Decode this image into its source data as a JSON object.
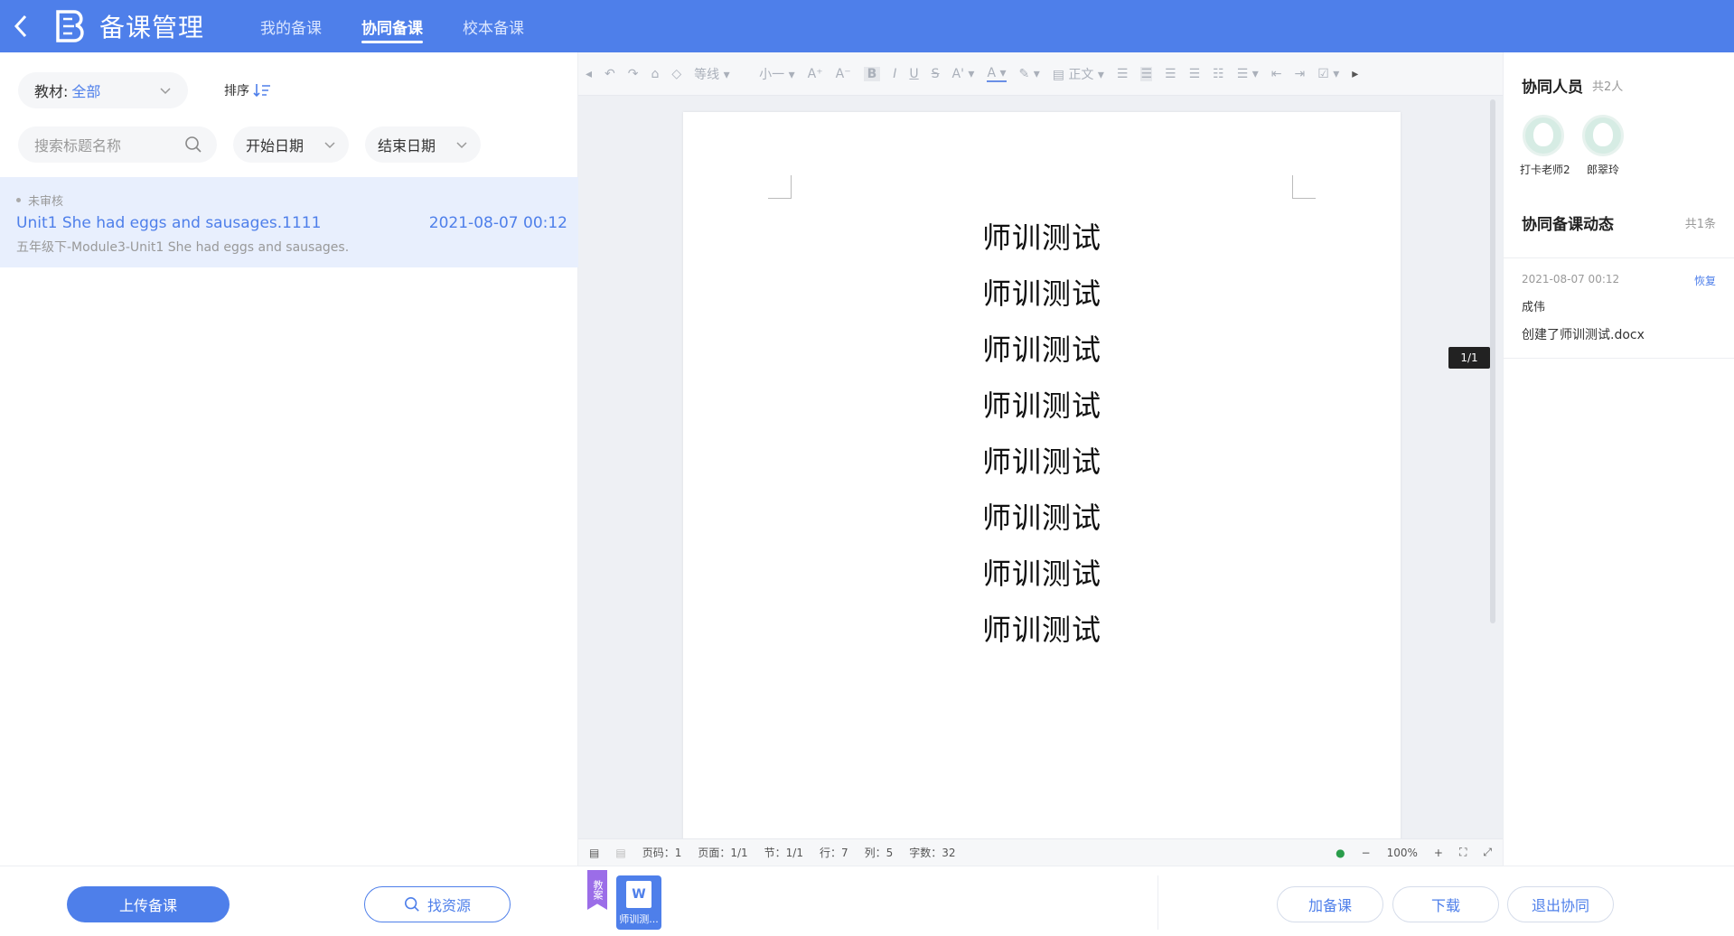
{
  "header": {
    "title": "备课管理",
    "tabs": [
      {
        "label": "我的备课",
        "active": false
      },
      {
        "label": "协同备课",
        "active": true
      },
      {
        "label": "校本备课",
        "active": false
      }
    ]
  },
  "filters": {
    "textbook_label": "教材:",
    "textbook_value": "全部",
    "sort_label": "排序",
    "search_placeholder": "搜索标题名称",
    "start_date": "开始日期",
    "end_date": "结束日期"
  },
  "list": [
    {
      "status": "未审核",
      "title": "Unit1 She had eggs and sausages.1111",
      "date": "2021-08-07 00:12",
      "subtitle": "五年级下-Module3-Unit1 She had eggs and sausages."
    }
  ],
  "editor": {
    "font_name": "等线",
    "font_size": "小一",
    "style_name": "正文",
    "doc_lines": [
      "师训测试",
      "师训测试",
      "师训测试",
      "师训测试",
      "师训测试",
      "师训测试",
      "师训测试",
      "师训测试"
    ],
    "page_tip": "1/1",
    "status": {
      "page_num": "页码：1",
      "pages": "页面：1/1",
      "section": "节：1/1",
      "row": "行：7",
      "col": "列：5",
      "words": "字数：32",
      "zoom": "100%"
    }
  },
  "right": {
    "members_title": "协同人员",
    "members_count": "共2人",
    "members": [
      {
        "name": "打卡老师2"
      },
      {
        "name": "郎翠玲"
      }
    ],
    "activity_title": "协同备课动态",
    "activity_count": "共1条",
    "activities": [
      {
        "time": "2021-08-07 00:12",
        "action": "恢复",
        "user": "成伟",
        "text": "创建了师训测试.docx"
      }
    ]
  },
  "bottom": {
    "upload": "上传备课",
    "find": "找资源",
    "file_tag": "教案",
    "file_name": "师训测...",
    "add": "加备课",
    "download": "下载",
    "exit": "退出协同"
  },
  "colors": {
    "accent": "#4e7fea",
    "header_bg": "#4e7fea",
    "selected_row": "#e8effd"
  }
}
